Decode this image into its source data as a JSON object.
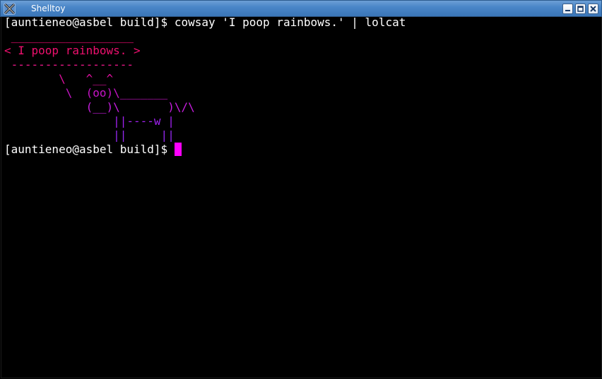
{
  "window": {
    "title": "Shelltoy",
    "icon": "x-logo-icon",
    "buttons": [
      "minimize-icon",
      "maximize-icon",
      "close-icon"
    ]
  },
  "terminal": {
    "prompt": "[auntieneo@asbel build]$ ",
    "command": "cowsay 'I poop rainbows.' | lolcat",
    "output": [
      {
        "text": " __________________",
        "color": "#ff0a78"
      },
      {
        "text": "< I poop rainbows. >",
        "color": "#f0106f"
      },
      {
        "text": " ------------------",
        "color": "#f0188c"
      },
      {
        "text": "        \\   ^__^",
        "color": "#e010a0"
      },
      {
        "text": "         \\  (oo)\\_______",
        "color": "#c814c8"
      },
      {
        "text": "            (__)\\       )\\/\\",
        "color": "#c81ee0"
      },
      {
        "text": "                ||----w |",
        "color": "#a020f0"
      },
      {
        "text": "                ||     ||",
        "color": "#9428f0"
      }
    ],
    "prompt2": "[auntieneo@asbel build]$ ",
    "text_color": "#ffffff",
    "background": "#000000",
    "cursor_color": "#ff00ff"
  }
}
